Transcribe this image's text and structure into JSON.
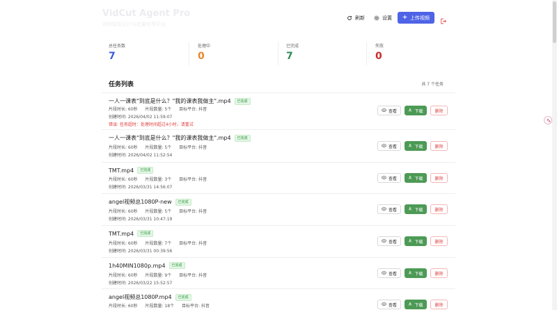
{
  "header": {
    "title": "VidCut Agent Pro",
    "subtitle": "视频智能切片与批量处理平台",
    "refresh_label": "刷新",
    "settings_label": "设置",
    "upload_label": "上传视频"
  },
  "stats": [
    {
      "label": "总任务数",
      "value": "7",
      "color": "#3b5bdb"
    },
    {
      "label": "处理中",
      "value": "0",
      "color": "#e8862a"
    },
    {
      "label": "已完成",
      "value": "7",
      "color": "#2e8b57"
    },
    {
      "label": "失败",
      "value": "0",
      "color": "#c92a2a"
    }
  ],
  "list": {
    "title": "任务列表",
    "count": "共 7 个任务",
    "view_label": "查看",
    "download_label": "下载",
    "delete_label": "删除",
    "tasks": [
      {
        "name": "一人一课表\"到底是什么？\"我的课表我做主\".mp4",
        "status": "已完成",
        "duration": "片段时长: 60秒",
        "count": "片段数量: 5个",
        "platform": "目标平台: 抖音",
        "created": "创建时间: 2026/04/02 11:59:07",
        "error": "错误: 任务超时：处理时间超过4小时，请重试"
      },
      {
        "name": "一人一课表\"到底是什么？\"我的课表我做主\".mp4",
        "status": "已完成",
        "duration": "片段时长: 60秒",
        "count": "片段数量: 5个",
        "platform": "目标平台: 抖音",
        "created": "创建时间: 2026/04/02 11:52:54"
      },
      {
        "name": "TMT.mp4",
        "status": "已完成",
        "duration": "片段时长: 60秒",
        "count": "片段数量: 3个",
        "platform": "目标平台: 抖音",
        "created": "创建时间: 2026/03/31 14:56:07"
      },
      {
        "name": "angel视频总1080P-new",
        "status": "已完成",
        "duration": "片段时长: 60秒",
        "count": "片段数量: 5个",
        "platform": "目标平台: 抖音",
        "created": "创建时间: 2026/03/31 10:47:19"
      },
      {
        "name": "TMT.mp4",
        "status": "已完成",
        "duration": "片段时长: 60秒",
        "count": "片段数量: 7个",
        "platform": "目标平台: 抖音",
        "created": "创建时间: 2026/03/31 00:39:56"
      },
      {
        "name": "1h40MIN1080p.mp4",
        "status": "已完成",
        "duration": "片段时长: 60秒",
        "count": "片段数量: 9个",
        "platform": "目标平台: 抖音",
        "created": "创建时间: 2026/03/22 15:52:57"
      },
      {
        "name": "angel视频总1080P.mp4",
        "status": "已完成",
        "duration": "片段时长: 60秒",
        "count": "片段数量: 18个",
        "platform": "目标平台: 抖音",
        "created": ""
      }
    ]
  }
}
